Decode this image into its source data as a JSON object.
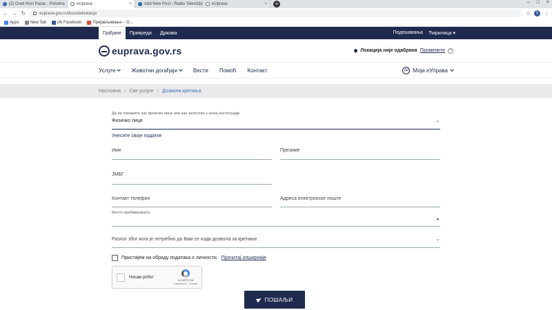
{
  "browser": {
    "tabs": [
      {
        "label": "(2) Grad Novi Pazar - Početna",
        "icon": "facebook-icon",
        "active": false
      },
      {
        "label": "eUprava",
        "icon": "euprava-icon",
        "active": true
      },
      {
        "label": "Add New Post ‹ Radio Televizija",
        "icon": "wordpress-icon",
        "active": false
      },
      {
        "label": "eUprava",
        "icon": "euprava-icon",
        "active": false
      }
    ],
    "url": "euprava.gov.rs/dozvolakretanja",
    "bookmarks": [
      {
        "label": "Apps",
        "color": "#4285f4"
      },
      {
        "label": "New Tab",
        "color": "#888888"
      },
      {
        "label": "(4) Facebook",
        "color": "#3b5998"
      },
      {
        "label": "Пријављивање – G...",
        "color": "#ea4335"
      }
    ],
    "profile_initial": "S"
  },
  "topnav": {
    "tabs": [
      "Грађани",
      "Привреда",
      "Држава"
    ],
    "settings": "Подешавања",
    "script": "Ћирилица"
  },
  "brand": {
    "logo_text": "euprava.gov.rs",
    "location_text": "Локација није одабрана",
    "location_change": "Промените",
    "help": "?"
  },
  "mainnav": {
    "items": [
      "Услуге",
      "Животни догађаји",
      "Вести",
      "Помоћ",
      "Контакт"
    ],
    "account_label": "Моја еУправа",
    "account_badge": "Да"
  },
  "breadcrumb": {
    "items": [
      "Насловна",
      "Све услуге",
      "Дозвола кретања"
    ],
    "separator": "›"
  },
  "form": {
    "applicant_type_label": "Да ли помажете као физичко лице или као запослен у некој институцији",
    "applicant_type_value": "Физичко лице",
    "section_title": "Унесите своје податке",
    "first_name": "Име",
    "last_name": "Презиме",
    "jmbg": "ЈМБГ",
    "phone": "Контакт телефон",
    "email": "Адреса електронске поште",
    "residence_label": "Место пребивалишта",
    "reason": "Разлог због кога је потребно да Вам се изда дозвола за кретање",
    "consent_text": "Пристајем на обраду података о личности.",
    "consent_link": "Прочитај опширније",
    "captcha_text": "Нисам робот",
    "captcha_brand": "reCAPTCHA",
    "captcha_terms": "Приватност - Услови",
    "submit": "ПОШАЉИ"
  },
  "colors": {
    "primary": "#1e2a4e",
    "link": "#3c6cb8",
    "breadcrumb_bg": "#eaeaea"
  }
}
